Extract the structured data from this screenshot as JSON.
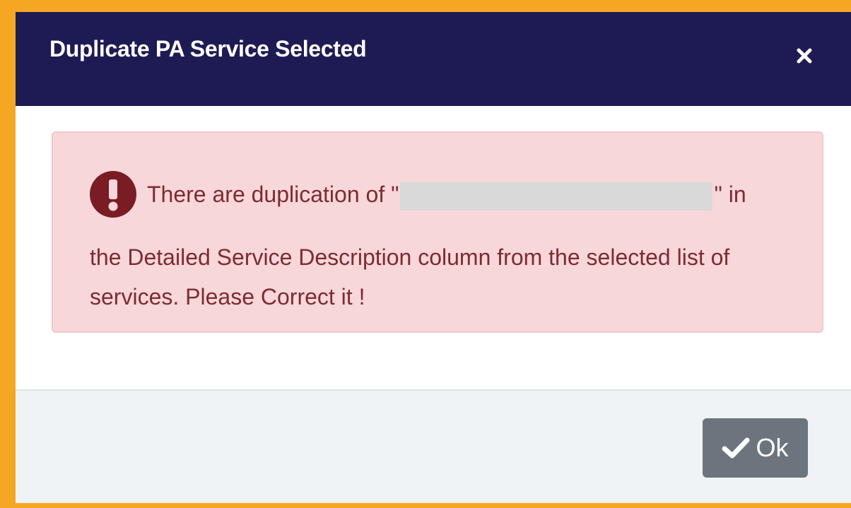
{
  "dialog": {
    "title": "Duplicate PA Service Selected",
    "close_icon": "close-icon"
  },
  "alert": {
    "icon": "exclamation-circle-icon",
    "text_before": "There are duplication of \"",
    "text_after": "\" in",
    "text_continuation": "the Detailed Service Description column from the selected list of services. Please Correct it !"
  },
  "footer": {
    "ok_icon": "check-icon",
    "ok_label": "Ok"
  },
  "colors": {
    "frame_border": "#f5a623",
    "header_bg": "#1e1b54",
    "alert_bg": "#f8d7da",
    "alert_text": "#7d2b32",
    "button_bg": "#6c757d"
  }
}
